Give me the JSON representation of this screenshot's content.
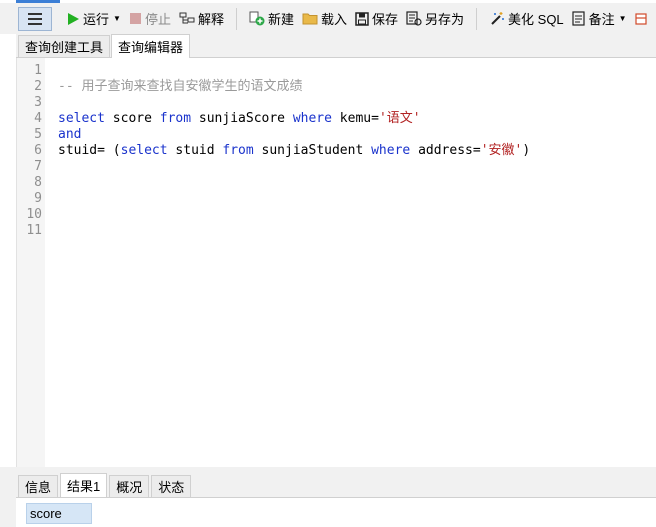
{
  "toolbar": {
    "run_label": "运行",
    "stop_label": "停止",
    "explain_label": "解释",
    "new_label": "新建",
    "load_label": "载入",
    "save_label": "保存",
    "save_as_label": "另存为",
    "beautify_label": "美化 SQL",
    "notes_label": "备注"
  },
  "tabs": [
    {
      "label": "查询创建工具",
      "active": false
    },
    {
      "label": "查询编辑器",
      "active": true
    }
  ],
  "editor": {
    "line_numbers": [
      "1",
      "2",
      "3",
      "4",
      "5",
      "6",
      "7",
      "8",
      "9",
      "10",
      "11"
    ],
    "line2_comment": "-- 用子查询来查找自安徽学生的语文成绩",
    "line4": {
      "kw1": "select",
      "t1": " score ",
      "kw2": "from",
      "t2": " sunjiaScore ",
      "kw3": "where",
      "t3": " kemu=",
      "s1": "'语文'"
    },
    "line5": {
      "kw1": "and"
    },
    "line6": {
      "t0": "stuid= (",
      "kw1": "select",
      "t1": " stuid ",
      "kw2": "from",
      "t2": " sunjiaStudent ",
      "kw3": "where",
      "t3": " address=",
      "s1": "'安徽'",
      "t4": ")"
    }
  },
  "bottom_tabs": [
    {
      "label": "信息",
      "active": false
    },
    {
      "label": "结果1",
      "active": true
    },
    {
      "label": "概况",
      "active": false
    },
    {
      "label": "状态",
      "active": false
    }
  ],
  "result": {
    "column_header": "score"
  },
  "colors": {
    "keyword": "#1a33cc",
    "comment": "#9a9a9a",
    "string": "#b22222",
    "accent": "#3c7fd6"
  }
}
